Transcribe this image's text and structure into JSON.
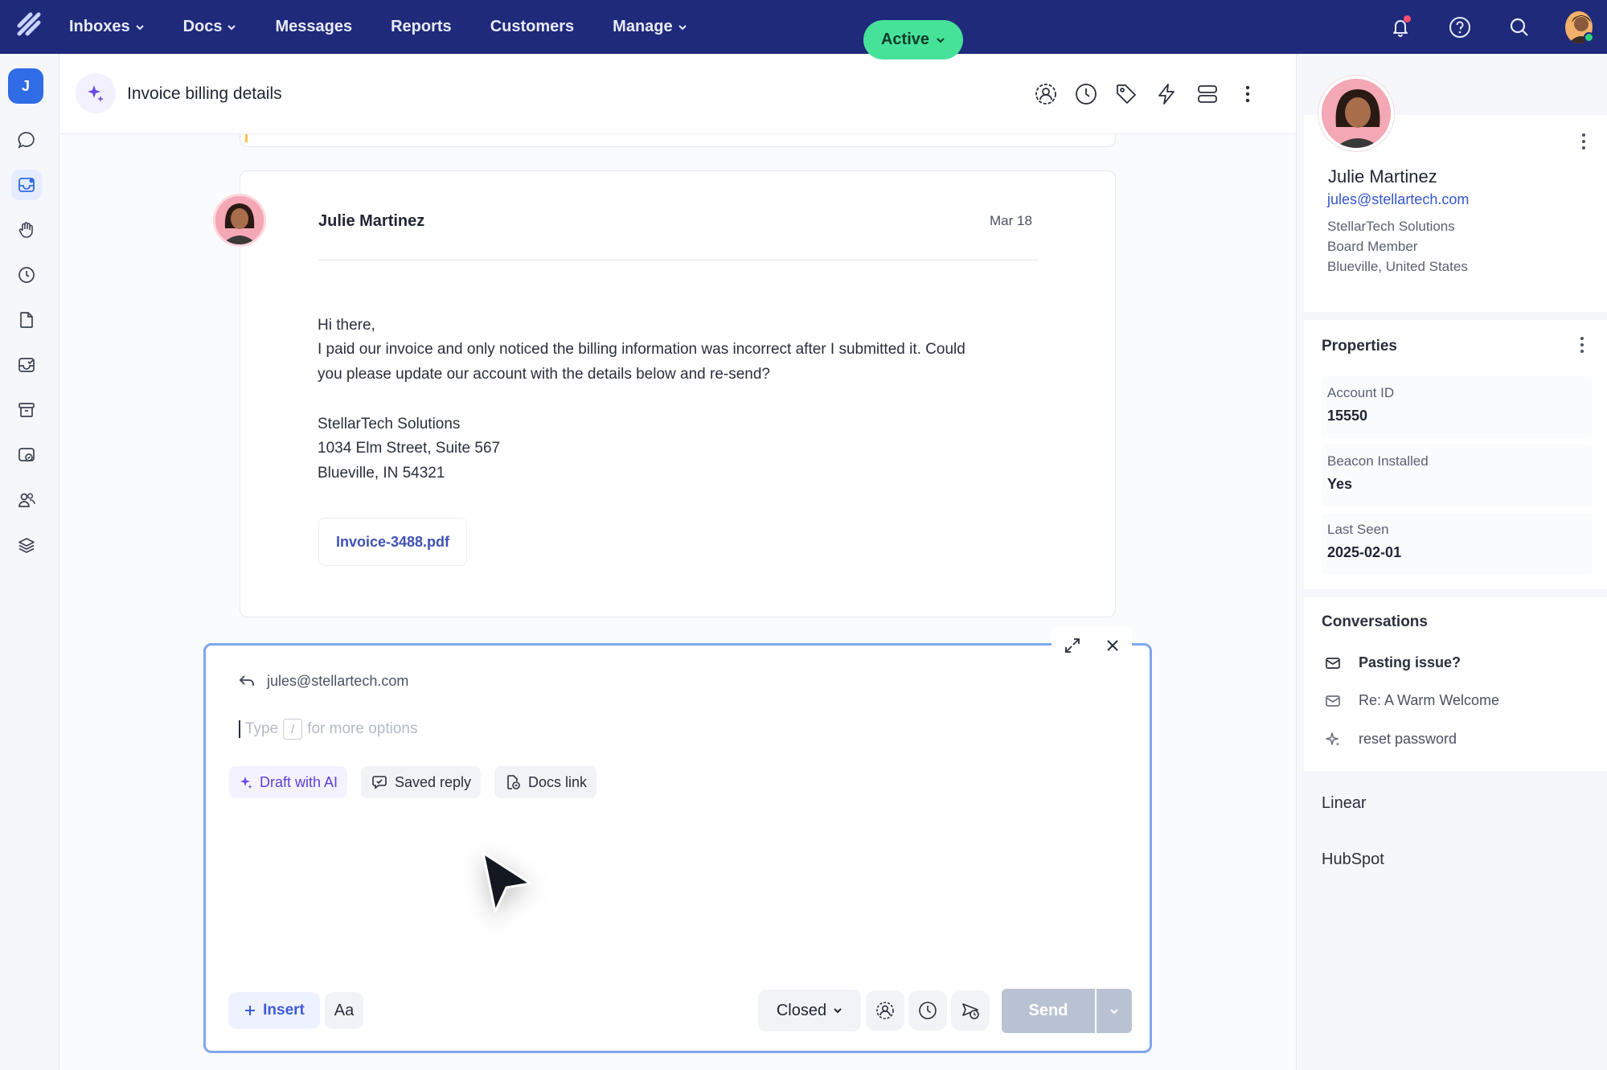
{
  "nav": {
    "items": [
      {
        "label": "Inboxes",
        "dropdown": true
      },
      {
        "label": "Docs",
        "dropdown": true
      },
      {
        "label": "Messages",
        "dropdown": false
      },
      {
        "label": "Reports",
        "dropdown": false
      },
      {
        "label": "Customers",
        "dropdown": false
      },
      {
        "label": "Manage",
        "dropdown": true
      }
    ],
    "icons": [
      "bell-icon",
      "help-icon",
      "search-icon",
      "user-avatar"
    ],
    "colors": {
      "bar": "#1f2a7a",
      "notification": "#ff4d73",
      "online": "#2fd27c"
    }
  },
  "rail": {
    "workspace_initial": "J",
    "icons": [
      "chat-icon",
      "inbox-icon",
      "hand-icon",
      "clock-icon",
      "document-icon",
      "check-inbox-icon",
      "archive-icon",
      "shield-icon",
      "people-icon",
      "layers-icon"
    ],
    "active_index": 1
  },
  "conversation": {
    "title": "Invoice billing details",
    "status": "Active",
    "status_color": "#46e29a",
    "header_icons": [
      "assign-icon",
      "snooze-clock-icon",
      "tag-icon",
      "lightning-icon",
      "layout-icon",
      "more-vertical-icon"
    ]
  },
  "message": {
    "sender": "Julie Martinez",
    "date": "Mar 18",
    "body": [
      "Hi there,",
      "I paid our invoice and only noticed the billing information was  incorrect after I submitted it. Could",
      "you please update our account with the details below and re-send?",
      "StellarTech Solutions",
      "1034 Elm Street, Suite 567",
      "Blueville, IN 54321"
    ],
    "attachment": "Invoice-3488.pdf"
  },
  "composer": {
    "to": "jules@stellartech.com",
    "placeholder_prefix": "Type",
    "placeholder_key": "/",
    "placeholder_suffix": "for more options",
    "chips": [
      {
        "label": "Draft with AI",
        "icon": "sparkle-icon"
      },
      {
        "label": "Saved reply",
        "icon": "saved-reply-icon"
      },
      {
        "label": "Docs link",
        "icon": "docs-link-icon"
      }
    ],
    "insert_label": "Insert",
    "format_label": "Aa",
    "status_label": "Closed",
    "send_label": "Send"
  },
  "customer": {
    "name": "Julie Martinez",
    "email": "jules@stellartech.com",
    "company": "StellarTech Solutions",
    "role": "Board Member",
    "location": "Blueville, United States"
  },
  "properties": {
    "title": "Properties",
    "items": [
      {
        "label": "Account ID",
        "value": "15550"
      },
      {
        "label": "Beacon Installed",
        "value": "Yes"
      },
      {
        "label": "Last Seen",
        "value": "2025-02-01"
      }
    ]
  },
  "conversations": {
    "title": "Conversations",
    "items": [
      {
        "label": "Pasting issue?",
        "icon": "envelope-icon"
      },
      {
        "label": "Re: A Warm Welcome",
        "icon": "envelope-icon"
      },
      {
        "label": "reset password",
        "icon": "sparkle-icon"
      }
    ]
  },
  "apps": [
    "Linear",
    "HubSpot"
  ]
}
